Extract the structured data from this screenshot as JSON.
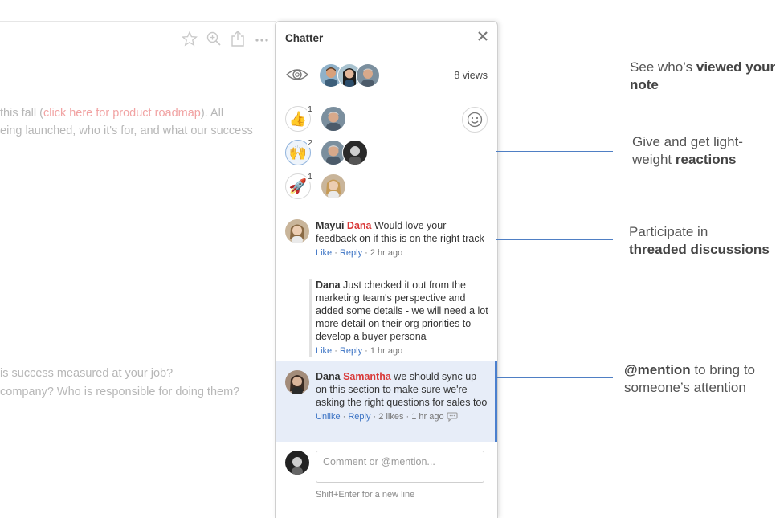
{
  "toolbar": {
    "icons": [
      "star-icon",
      "zoom-in-icon",
      "share-icon",
      "more-icon"
    ]
  },
  "document": {
    "line1_prefix": "this fall (",
    "line1_link": "click here for product roadmap",
    "line1_suffix": "). All",
    "line2": "eing launched, who it's for, and what our success",
    "line3": "is success measured at your job?",
    "line4": "company? Who is responsible for doing them?"
  },
  "chatter": {
    "title": "Chatter",
    "close_label": "✕",
    "views_label": "8 views",
    "reactions": [
      {
        "emoji": "👍",
        "count": "1"
      },
      {
        "emoji": "🙌",
        "count": "2"
      },
      {
        "emoji": "🚀",
        "count": "1"
      }
    ],
    "comments": [
      {
        "author": "Mayui",
        "mention": "Dana",
        "text": " Would love your feedback on if this is on the right track",
        "like": "Like",
        "reply": "Reply",
        "time": "· 2 hr ago"
      },
      {
        "author": "Dana",
        "text": " Just checked it out from the marketing team's perspective and added some details - we will need a lot more detail on their org priorities to develop a buyer persona",
        "like": "Like",
        "reply": "Reply",
        "time": "· 1 hr ago"
      },
      {
        "author": "Dana",
        "mention": "Samantha",
        "text": " we should sync up on this section to make sure we're asking the right questions for sales too",
        "like": "Unlike",
        "reply": "Reply",
        "likes": "· 2 likes",
        "time": "· 1 hr ago"
      }
    ],
    "composer": {
      "placeholder": "Comment or @mention...",
      "hint": "Shift+Enter for a new line"
    }
  },
  "callouts": {
    "c1_pre": "See who’s ",
    "c1_bold": "viewed your",
    "c1_bold2": "note",
    "c2_pre": "Give and get light-",
    "c2_pre2": "weight ",
    "c2_bold": "reactions",
    "c3_pre": "Participate in",
    "c3_bold": "threaded discussions",
    "c4_bold": "@mention",
    "c4_post": " to bring to",
    "c4_post2": "someone’s attention"
  },
  "colors": {
    "accent_blue": "#4f7fc4",
    "mention_red": "#d93939",
    "link_blue": "#3b73c4",
    "highlight_bg": "#e7edf8"
  }
}
